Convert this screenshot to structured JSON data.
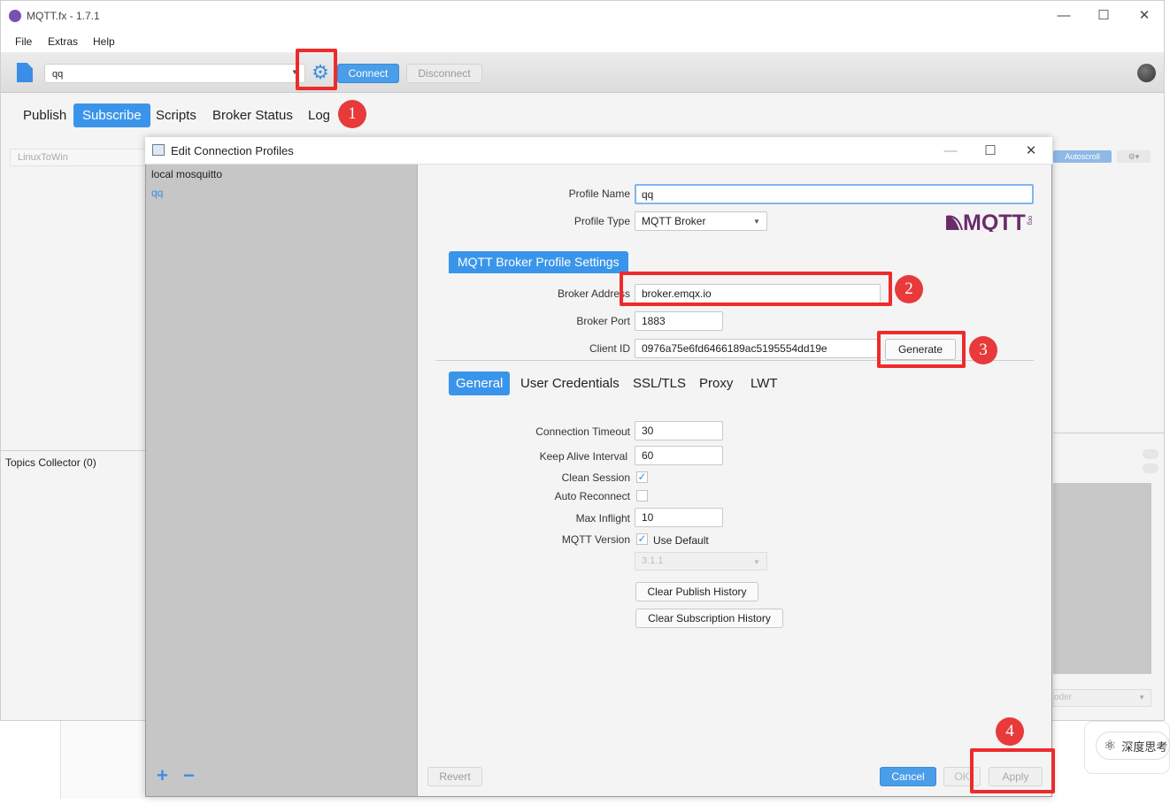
{
  "app": {
    "title": "MQTT.fx - 1.7.1",
    "menu": [
      "File",
      "Extras",
      "Help"
    ],
    "profile_combo_value": "qq",
    "connect_label": "Connect",
    "disconnect_label": "Disconnect",
    "tabs": [
      "Publish",
      "Subscribe",
      "Scripts",
      "Broker Status",
      "Log"
    ],
    "active_tab": "Subscribe",
    "topic_field_value": "LinuxToWin",
    "topics_collector": "Topics Collector (0)",
    "autoscroll_label": "Autoscroll",
    "decoder_partial": "oder"
  },
  "background": {
    "deep_think_label": "深度思考"
  },
  "dialog": {
    "title": "Edit Connection Profiles",
    "profiles": [
      "local mosquitto",
      "qq"
    ],
    "selected_profile": "qq",
    "fields": {
      "profile_name_label": "Profile Name",
      "profile_name_value": "qq",
      "profile_type_label": "Profile Type",
      "profile_type_value": "MQTT Broker",
      "section_header": "MQTT Broker Profile Settings",
      "broker_address_label": "Broker Address",
      "broker_address_value": "broker.emqx.io",
      "broker_port_label": "Broker Port",
      "broker_port_value": "1883",
      "client_id_label": "Client ID",
      "client_id_value": "0976a75e6fd6466189ac5195554dd19e",
      "generate_label": "Generate"
    },
    "tabs": [
      "General",
      "User Credentials",
      "SSL/TLS",
      "Proxy",
      "LWT"
    ],
    "active_tab": "General",
    "general": {
      "connection_timeout_label": "Connection Timeout",
      "connection_timeout_value": "30",
      "keep_alive_label": "Keep Alive Interval",
      "keep_alive_value": "60",
      "clean_session_label": "Clean Session",
      "clean_session_checked": true,
      "auto_reconnect_label": "Auto Reconnect",
      "auto_reconnect_checked": false,
      "max_inflight_label": "Max Inflight",
      "max_inflight_value": "10",
      "mqtt_version_label": "MQTT Version",
      "use_default_label": "Use Default",
      "use_default_checked": true,
      "mqtt_version_value": "3.1.1",
      "clear_publish_label": "Clear Publish History",
      "clear_subscription_label": "Clear Subscription History"
    },
    "buttons": {
      "add": "+",
      "remove": "−",
      "revert": "Revert",
      "cancel": "Cancel",
      "ok": "OK",
      "apply": "Apply"
    },
    "logo_text": "MQTT",
    "logo_sub": "org"
  },
  "annotations": [
    "1",
    "2",
    "3",
    "4"
  ],
  "colors": {
    "accent": "#3a95ea",
    "callout": "#ee2b2b",
    "badge": "#e83a3a",
    "profile_list_bg": "#c6c6c6",
    "logo": "#6b2b6b"
  }
}
